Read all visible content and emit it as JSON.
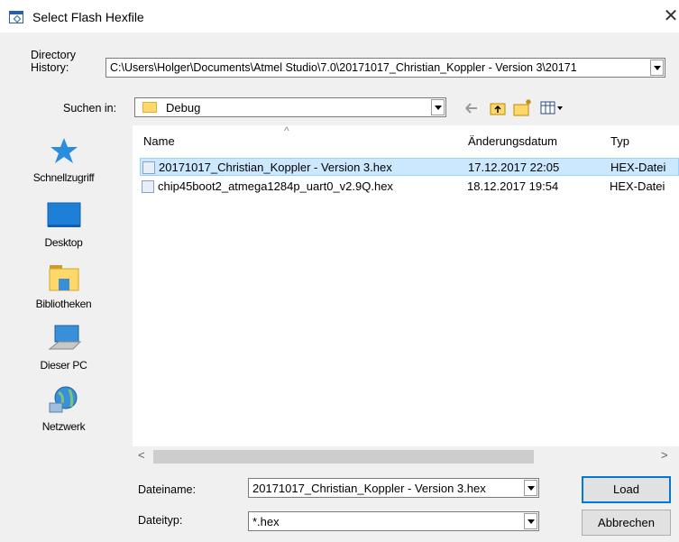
{
  "window": {
    "title": "Select Flash Hexfile",
    "close_glyph": "✕"
  },
  "history": {
    "label_line1": "Directory",
    "label_line2": "History:",
    "value": "C:\\Users\\Holger\\Documents\\Atmel Studio\\7.0\\20171017_Christian_Koppler - Version 3\\20171"
  },
  "location": {
    "label": "Suchen in:",
    "value": "Debug",
    "icons": [
      "back-arrow-icon",
      "up-folder-icon",
      "new-folder-icon",
      "view-menu-icon"
    ]
  },
  "sidebar": {
    "items": [
      {
        "label": "Schnellzugriff",
        "icon": "star-icon"
      },
      {
        "label": "Desktop",
        "icon": "desktop-icon"
      },
      {
        "label": "Bibliotheken",
        "icon": "library-icon"
      },
      {
        "label": "Dieser PC",
        "icon": "computer-icon"
      },
      {
        "label": "Netzwerk",
        "icon": "network-icon"
      }
    ]
  },
  "file_list": {
    "columns": [
      "Name",
      "Änderungsdatum",
      "Typ"
    ],
    "sort_glyph": "^",
    "rows": [
      {
        "name": "20171017_Christian_Koppler - Version 3.hex",
        "date": "17.12.2017 22:05",
        "type": "HEX-Datei",
        "selected": true
      },
      {
        "name": "chip45boot2_atmega1284p_uart0_v2.9Q.hex",
        "date": "18.12.2017 19:54",
        "type": "HEX-Datei",
        "selected": false
      }
    ]
  },
  "scrollbar": {
    "left_glyph": "<",
    "right_glyph": ">"
  },
  "filename": {
    "label": "Dateiname:",
    "value": "20171017_Christian_Koppler - Version 3.hex"
  },
  "filetype": {
    "label": "Dateityp:",
    "value": "*.hex"
  },
  "buttons": {
    "load": "Load",
    "cancel": "Abbrechen"
  },
  "colors": {
    "selection": "#cce8ff",
    "accent": "#0078d7"
  }
}
